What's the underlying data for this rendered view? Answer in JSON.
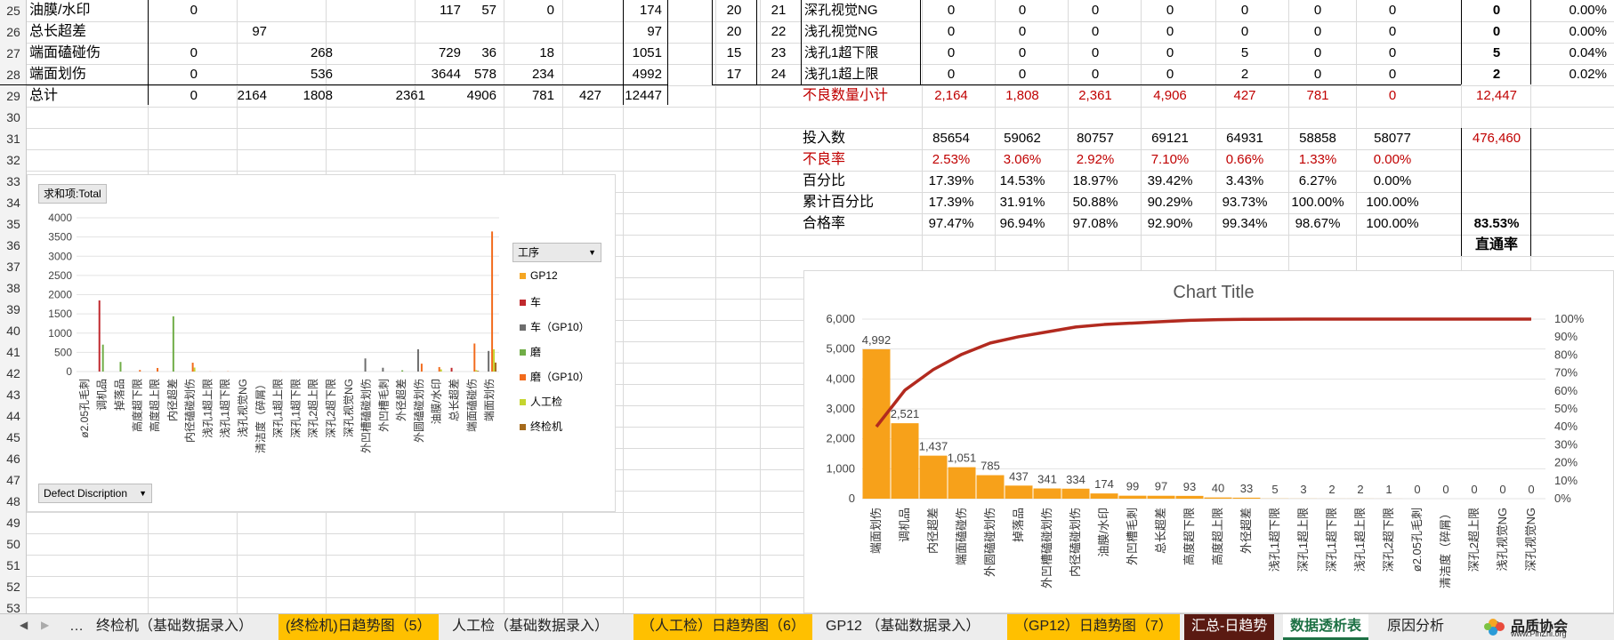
{
  "row_numbers": [
    "25",
    "26",
    "27",
    "28",
    "29",
    "30",
    "31",
    "32",
    "33",
    "34",
    "35",
    "36",
    "37",
    "38",
    "39",
    "40",
    "41",
    "42",
    "43",
    "44",
    "45",
    "46",
    "47",
    "48",
    "49",
    "50",
    "51",
    "52",
    "53"
  ],
  "left_table": {
    "rows": [
      {
        "label": "油膜/水印",
        "vals": [
          "0",
          "",
          "",
          "117",
          "57",
          "0",
          "174"
        ]
      },
      {
        "label": "总长超差",
        "vals": [
          "",
          "97",
          "",
          "",
          "",
          "",
          "97"
        ]
      },
      {
        "label": "端面磕碰伤",
        "vals": [
          "0",
          "",
          "268",
          "729",
          "36",
          "18",
          "1051"
        ]
      },
      {
        "label": "端面划伤",
        "vals": [
          "0",
          "",
          "536",
          "3644",
          "578",
          "234",
          "4992"
        ]
      },
      {
        "label": "总计",
        "vals": [
          "0",
          "2164",
          "1808",
          "2361",
          "4906",
          "781",
          "427",
          "12447"
        ]
      }
    ]
  },
  "right_table": {
    "rows": [
      {
        "a": "20",
        "b": "21",
        "label": "深孔视觉NG",
        "vals": [
          "0",
          "0",
          "0",
          "0",
          "0",
          "0",
          "0"
        ],
        "total": "0",
        "pct": "0.00%"
      },
      {
        "a": "20",
        "b": "22",
        "label": "浅孔视觉NG",
        "vals": [
          "0",
          "0",
          "0",
          "0",
          "0",
          "0",
          "0"
        ],
        "total": "0",
        "pct": "0.00%"
      },
      {
        "a": "15",
        "b": "23",
        "label": "浅孔1超下限",
        "vals": [
          "0",
          "0",
          "0",
          "0",
          "5",
          "0",
          "0"
        ],
        "total": "5",
        "pct": "0.04%"
      },
      {
        "a": "17",
        "b": "24",
        "label": "浅孔1超上限",
        "vals": [
          "0",
          "0",
          "0",
          "0",
          "2",
          "0",
          "0"
        ],
        "total": "2",
        "pct": "0.02%"
      }
    ],
    "subtotal": {
      "label": "不良数量小计",
      "vals": [
        "2,164",
        "1,808",
        "2,361",
        "4,906",
        "427",
        "781",
        "0"
      ],
      "total": "12,447"
    },
    "input": {
      "label": "投入数",
      "vals": [
        "85654",
        "59062",
        "80757",
        "69121",
        "64931",
        "58858",
        "58077"
      ],
      "total": "476,460"
    },
    "defect_rate": {
      "label": "不良率",
      "vals": [
        "2.53%",
        "3.06%",
        "2.92%",
        "7.10%",
        "0.66%",
        "1.33%",
        "0.00%"
      ]
    },
    "percent": {
      "label": "百分比",
      "vals": [
        "17.39%",
        "14.53%",
        "18.97%",
        "39.42%",
        "3.43%",
        "6.27%",
        "0.00%"
      ]
    },
    "cumulative": {
      "label": "累计百分比",
      "vals": [
        "17.39%",
        "31.91%",
        "50.88%",
        "90.29%",
        "93.73%",
        "100.00%",
        "100.00%"
      ]
    },
    "pass_rate": {
      "label": "合格率",
      "vals": [
        "97.47%",
        "96.94%",
        "97.08%",
        "92.90%",
        "99.34%",
        "98.67%",
        "100.00%"
      ],
      "total": "83.53%"
    },
    "first_pass_label": "直通率"
  },
  "pivot_chart": {
    "sum_button": "求和项:Total",
    "legend_button": "工序",
    "axis_button": "Defect Discription",
    "chart_data": {
      "type": "bar",
      "ylim": [
        0,
        4000
      ],
      "yticks": [
        "0",
        "500",
        "1000",
        "1500",
        "2000",
        "2500",
        "3000",
        "3500",
        "4000"
      ],
      "categories": [
        "ø2.05孔毛刺",
        "调机品",
        "掉落品",
        "高度超下限",
        "高度超上限",
        "内径超差",
        "内径磕碰划伤",
        "浅孔1超上限",
        "浅孔1超下限",
        "浅孔视觉NG",
        "清洁度（碎屑）",
        "深孔1超上限",
        "深孔1超下限",
        "深孔2超上限",
        "深孔2超下限",
        "深孔视觉NG",
        "外凹槽磕碰划伤",
        "外凹槽毛刺",
        "外径超差",
        "外圆磕碰划伤",
        "油膜/水印",
        "总长超差",
        "端面磕碰伤",
        "端面划伤"
      ],
      "series": [
        {
          "name": "GP12",
          "color": "#f5a623",
          "values": [
            0,
            0,
            0,
            0,
            0,
            0,
            0,
            0,
            0,
            0,
            0,
            0,
            0,
            0,
            0,
            0,
            0,
            0,
            0,
            0,
            0,
            0,
            0,
            0
          ]
        },
        {
          "name": "车",
          "color": "#c0282d",
          "values": [
            0,
            1850,
            0,
            0,
            0,
            0,
            0,
            0,
            0,
            0,
            0,
            0,
            0,
            0,
            0,
            0,
            0,
            0,
            0,
            0,
            0,
            97,
            0,
            0
          ]
        },
        {
          "name": "车（GP10）",
          "color": "#6d6d6d",
          "values": [
            0,
            0,
            0,
            0,
            0,
            0,
            0,
            0,
            0,
            0,
            0,
            0,
            0,
            0,
            0,
            0,
            341,
            99,
            0,
            580,
            0,
            0,
            0,
            536
          ]
        },
        {
          "name": "磨",
          "color": "#70ad47",
          "values": [
            0,
            700,
            250,
            0,
            0,
            1437,
            0,
            0,
            0,
            0,
            0,
            0,
            0,
            0,
            0,
            0,
            0,
            0,
            33,
            0,
            0,
            0,
            0,
            0
          ]
        },
        {
          "name": "磨（GP10）",
          "color": "#f26b1d",
          "values": [
            0,
            0,
            0,
            40,
            93,
            0,
            230,
            3,
            5,
            0,
            0,
            2,
            2,
            1,
            0,
            0,
            0,
            0,
            0,
            205,
            117,
            0,
            729,
            3644
          ]
        },
        {
          "name": "人工检",
          "color": "#c5d52f",
          "values": [
            0,
            0,
            0,
            0,
            0,
            0,
            104,
            0,
            0,
            0,
            0,
            0,
            0,
            0,
            0,
            0,
            0,
            0,
            0,
            0,
            57,
            0,
            36,
            578
          ]
        },
        {
          "name": "终检机",
          "color": "#a56a1c",
          "values": [
            0,
            0,
            0,
            0,
            0,
            0,
            0,
            0,
            0,
            0,
            0,
            0,
            0,
            0,
            0,
            0,
            0,
            0,
            0,
            0,
            0,
            0,
            18,
            234
          ]
        }
      ]
    }
  },
  "pareto_chart": {
    "chart_data": {
      "type": "bar",
      "title": "Chart Title",
      "ylim": [
        0,
        6000
      ],
      "yticks": [
        "0",
        "1,000",
        "2,000",
        "3,000",
        "4,000",
        "5,000",
        "6,000"
      ],
      "y2ticks": [
        "0%",
        "10%",
        "20%",
        "30%",
        "40%",
        "50%",
        "60%",
        "70%",
        "80%",
        "90%",
        "100%"
      ],
      "categories": [
        "端面划伤",
        "调机品",
        "内径超差",
        "端面磕碰伤",
        "外圆磕碰划伤",
        "掉落品",
        "外凹槽磕碰划伤",
        "内径磕碰划伤",
        "油膜/水印",
        "外凹槽毛刺",
        "总长超差",
        "高度超下限",
        "高度超上限",
        "外径超差",
        "浅孔1超下限",
        "深孔1超上限",
        "深孔1超下限",
        "浅孔1超上限",
        "深孔2超下限",
        "ø2.05孔毛刺",
        "清洁度（碎屑）",
        "深孔2超上限",
        "浅孔视觉NG",
        "深孔视觉NG"
      ],
      "values": [
        4992,
        2521,
        1437,
        1051,
        785,
        437,
        341,
        334,
        174,
        99,
        97,
        93,
        40,
        33,
        5,
        3,
        2,
        2,
        1,
        0,
        0,
        0,
        0,
        0
      ],
      "labels": [
        "4,992",
        "2,521",
        "1,437",
        "1,051",
        "785",
        "437",
        "341",
        "334",
        "174",
        "99",
        "97",
        "93",
        "40",
        "33",
        "5",
        "3",
        "2",
        "2",
        "1",
        "0",
        "0",
        "0",
        "0",
        "0"
      ],
      "cumulative_pct": [
        40.1,
        60.4,
        71.9,
        80.4,
        86.7,
        90.2,
        92.9,
        95.6,
        97.0,
        97.8,
        98.6,
        99.3,
        99.7,
        99.9,
        99.95,
        99.97,
        99.98,
        100,
        100,
        100,
        100,
        100,
        100,
        100
      ],
      "bar_color": "#f7a11a",
      "line_color": "#b22a1f"
    }
  },
  "tabs": [
    {
      "label": "…",
      "style": "plain"
    },
    {
      "label": "终检机（基础数据录入）",
      "style": "plain"
    },
    {
      "label": "(终检机)日趋势图（5）",
      "style": "yellow"
    },
    {
      "label": "人工检（基础数据录入）",
      "style": "plain"
    },
    {
      "label": "（人工检）日趋势图（6）",
      "style": "yellow"
    },
    {
      "label": "GP12 （基础数据录入）",
      "style": "plain"
    },
    {
      "label": "（GP12）日趋势图（7）",
      "style": "yellow"
    },
    {
      "label": "汇总-日趋势",
      "style": "dark"
    },
    {
      "label": "数据透析表",
      "style": "active"
    },
    {
      "label": "原因分析",
      "style": "plain"
    }
  ],
  "logo": {
    "text": "品质协会",
    "url_text": "www.PinZhi.org"
  }
}
